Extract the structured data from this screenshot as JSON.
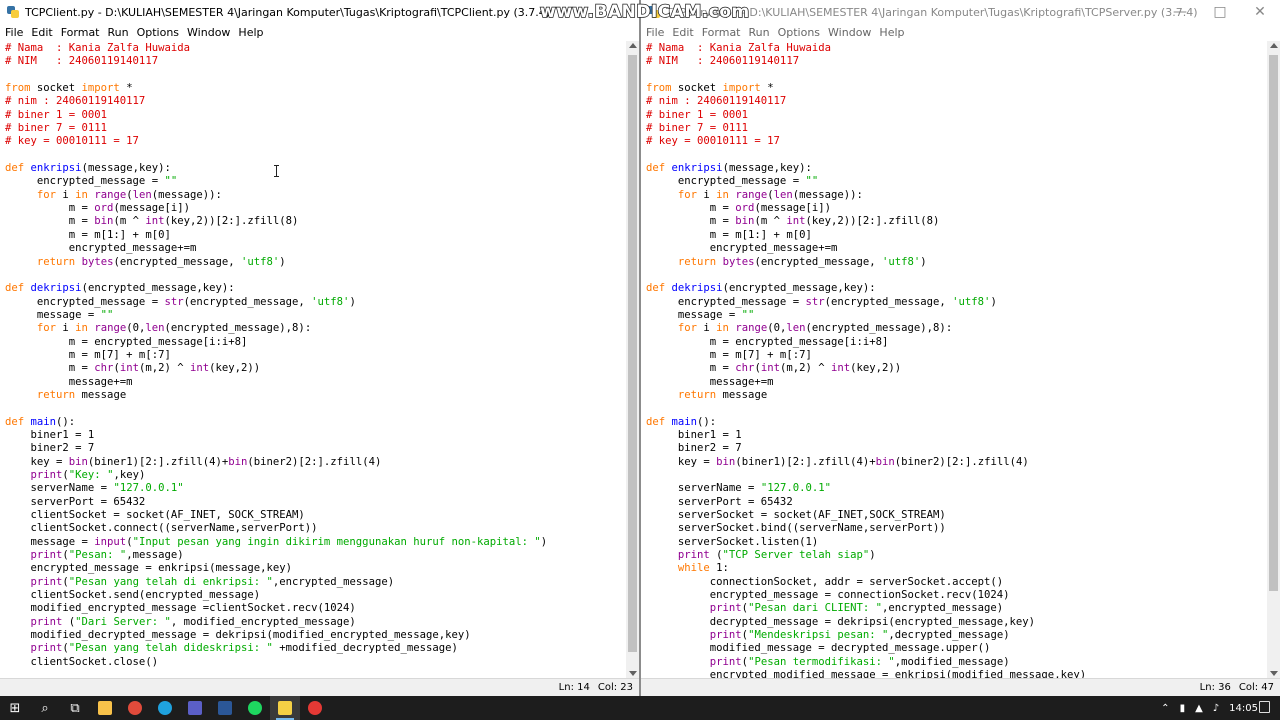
{
  "watermark": "www.BANDICAM.com",
  "left_window": {
    "title": "TCPClient.py - D:\\KULIAH\\SEMESTER 4\\Jaringan Komputer\\Tugas\\Kriptografi\\TCPClient.py (3.7.4)",
    "menu": [
      "File",
      "Edit",
      "Format",
      "Run",
      "Options",
      "Window",
      "Help"
    ],
    "status": {
      "line": "Ln: 14",
      "col": "Col: 23"
    }
  },
  "right_window": {
    "title": "TCPServer.py - D:\\KULIAH\\SEMESTER 4\\Jaringan Komputer\\Tugas\\Kriptografi\\TCPServer.py (3.7.4)",
    "menu": [
      "File",
      "Edit",
      "Format",
      "Run",
      "Options",
      "Window",
      "Help"
    ],
    "status": {
      "line": "Ln: 36",
      "col": "Col: 47"
    }
  },
  "client_code": [
    [
      [
        "cm",
        "# Nama  : Kania Zalfa Huwaida"
      ]
    ],
    [
      [
        "cm",
        "# NIM   : 24060119140117"
      ]
    ],
    [],
    [
      [
        "kw",
        "from"
      ],
      [
        "",
        " socket "
      ],
      [
        "kw",
        "import"
      ],
      [
        "",
        " *"
      ]
    ],
    [
      [
        "cm",
        "# nim : 24060119140117"
      ]
    ],
    [
      [
        "cm",
        "# biner 1 = 0001"
      ]
    ],
    [
      [
        "cm",
        "# biner 7 = 0111"
      ]
    ],
    [
      [
        "cm",
        "# key = 00010111 = 17"
      ]
    ],
    [],
    [
      [
        "kw",
        "def"
      ],
      [
        "",
        " "
      ],
      [
        "df",
        "enkripsi"
      ],
      [
        "",
        "(message,key):"
      ]
    ],
    [
      [
        "",
        "     encrypted_message = "
      ],
      [
        "st",
        "\"\""
      ]
    ],
    [
      [
        "kw",
        "     for"
      ],
      [
        "",
        " i "
      ],
      [
        "kw",
        "in"
      ],
      [
        "",
        " "
      ],
      [
        "bi",
        "range"
      ],
      [
        "",
        "("
      ],
      [
        "bi",
        "len"
      ],
      [
        "",
        "(message)):"
      ]
    ],
    [
      [
        "",
        "          m = "
      ],
      [
        "bi",
        "ord"
      ],
      [
        "",
        "(message[i])"
      ]
    ],
    [
      [
        "",
        "          m = "
      ],
      [
        "bi",
        "bin"
      ],
      [
        "",
        "(m ^ "
      ],
      [
        "bi",
        "int"
      ],
      [
        "",
        "(key,2))[2:].zfill(8)"
      ]
    ],
    [
      [
        "",
        "          m = m[1:] + m[0]"
      ]
    ],
    [
      [
        "",
        "          encrypted_message+=m"
      ]
    ],
    [
      [
        "kw",
        "     return"
      ],
      [
        "",
        " "
      ],
      [
        "bi",
        "bytes"
      ],
      [
        "",
        "(encrypted_message, "
      ],
      [
        "st",
        "'utf8'"
      ],
      [
        "",
        ")"
      ]
    ],
    [],
    [
      [
        "kw",
        "def"
      ],
      [
        "",
        " "
      ],
      [
        "df",
        "dekripsi"
      ],
      [
        "",
        "(encrypted_message,key):"
      ]
    ],
    [
      [
        "",
        "     encrypted_message = "
      ],
      [
        "bi",
        "str"
      ],
      [
        "",
        "(encrypted_message, "
      ],
      [
        "st",
        "'utf8'"
      ],
      [
        "",
        ")"
      ]
    ],
    [
      [
        "",
        "     message = "
      ],
      [
        "st",
        "\"\""
      ]
    ],
    [
      [
        "kw",
        "     for"
      ],
      [
        "",
        " i "
      ],
      [
        "kw",
        "in"
      ],
      [
        "",
        " "
      ],
      [
        "bi",
        "range"
      ],
      [
        "",
        "(0,"
      ],
      [
        "bi",
        "len"
      ],
      [
        "",
        "(encrypted_message),8):"
      ]
    ],
    [
      [
        "",
        "          m = encrypted_message[i:i+8]"
      ]
    ],
    [
      [
        "",
        "          m = m[7] + m[:7]"
      ]
    ],
    [
      [
        "",
        "          m = "
      ],
      [
        "bi",
        "chr"
      ],
      [
        "",
        "("
      ],
      [
        "bi",
        "int"
      ],
      [
        "",
        "(m,2) ^ "
      ],
      [
        "bi",
        "int"
      ],
      [
        "",
        "(key,2))"
      ]
    ],
    [
      [
        "",
        "          message+=m"
      ]
    ],
    [
      [
        "kw",
        "     return"
      ],
      [
        "",
        " message"
      ]
    ],
    [],
    [
      [
        "kw",
        "def"
      ],
      [
        "",
        " "
      ],
      [
        "df",
        "main"
      ],
      [
        "",
        "():"
      ]
    ],
    [
      [
        "",
        "    biner1 = 1"
      ]
    ],
    [
      [
        "",
        "    biner2 = 7"
      ]
    ],
    [
      [
        "",
        "    key = "
      ],
      [
        "bi",
        "bin"
      ],
      [
        "",
        "(biner1)[2:].zfill(4)+"
      ],
      [
        "bi",
        "bin"
      ],
      [
        "",
        "(biner2)[2:].zfill(4)"
      ]
    ],
    [
      [
        "bi",
        "    print"
      ],
      [
        "",
        "("
      ],
      [
        "st",
        "\"Key: \""
      ],
      [
        "",
        ",key)"
      ]
    ],
    [
      [
        "",
        "    serverName = "
      ],
      [
        "st",
        "\"127.0.0.1\""
      ]
    ],
    [
      [
        "",
        "    serverPort = 65432"
      ]
    ],
    [
      [
        "",
        "    clientSocket = socket(AF_INET, SOCK_STREAM)"
      ]
    ],
    [
      [
        "",
        "    clientSocket.connect((serverName,serverPort))"
      ]
    ],
    [
      [
        "",
        "    message = "
      ],
      [
        "bi",
        "input"
      ],
      [
        "",
        "("
      ],
      [
        "st",
        "\"Input pesan yang ingin dikirim menggunakan huruf non-kapital: \""
      ],
      [
        "",
        ")"
      ]
    ],
    [
      [
        "bi",
        "    print"
      ],
      [
        "",
        "("
      ],
      [
        "st",
        "\"Pesan: \""
      ],
      [
        "",
        ",message)"
      ]
    ],
    [
      [
        "",
        "    encrypted_message = enkripsi(message,key)"
      ]
    ],
    [
      [
        "bi",
        "    print"
      ],
      [
        "",
        "("
      ],
      [
        "st",
        "\"Pesan yang telah di enkripsi: \""
      ],
      [
        "",
        ",encrypted_message)"
      ]
    ],
    [
      [
        "",
        "    clientSocket.send(encrypted_message)"
      ]
    ],
    [
      [
        "",
        "    modified_encrypted_message =clientSocket.recv(1024)"
      ]
    ],
    [
      [
        "bi",
        "    print"
      ],
      [
        "",
        " ("
      ],
      [
        "st",
        "\"Dari Server: \""
      ],
      [
        "",
        ", modified_encrypted_message)"
      ]
    ],
    [
      [
        "",
        "    modified_decrypted_message = dekripsi(modified_encrypted_message,key)"
      ]
    ],
    [
      [
        "bi",
        "    print"
      ],
      [
        "",
        "("
      ],
      [
        "st",
        "\"Pesan yang telah dideskripsi: \""
      ],
      [
        "",
        " +modified_decrypted_message)"
      ]
    ],
    [
      [
        "",
        "    clientSocket.close()"
      ]
    ]
  ],
  "server_code": [
    [
      [
        "cm",
        "# Nama  : Kania Zalfa Huwaida"
      ]
    ],
    [
      [
        "cm",
        "# NIM   : 24060119140117"
      ]
    ],
    [],
    [
      [
        "kw",
        "from"
      ],
      [
        "",
        " socket "
      ],
      [
        "kw",
        "import"
      ],
      [
        "",
        " *"
      ]
    ],
    [
      [
        "cm",
        "# nim : 24060119140117"
      ]
    ],
    [
      [
        "cm",
        "# biner 1 = 0001"
      ]
    ],
    [
      [
        "cm",
        "# biner 7 = 0111"
      ]
    ],
    [
      [
        "cm",
        "# key = 00010111 = 17"
      ]
    ],
    [],
    [
      [
        "kw",
        "def"
      ],
      [
        "",
        " "
      ],
      [
        "df",
        "enkripsi"
      ],
      [
        "",
        "(message,key):"
      ]
    ],
    [
      [
        "",
        "     encrypted_message = "
      ],
      [
        "st",
        "\"\""
      ]
    ],
    [
      [
        "kw",
        "     for"
      ],
      [
        "",
        " i "
      ],
      [
        "kw",
        "in"
      ],
      [
        "",
        " "
      ],
      [
        "bi",
        "range"
      ],
      [
        "",
        "("
      ],
      [
        "bi",
        "len"
      ],
      [
        "",
        "(message)):"
      ]
    ],
    [
      [
        "",
        "          m = "
      ],
      [
        "bi",
        "ord"
      ],
      [
        "",
        "(message[i])"
      ]
    ],
    [
      [
        "",
        "          m = "
      ],
      [
        "bi",
        "bin"
      ],
      [
        "",
        "(m ^ "
      ],
      [
        "bi",
        "int"
      ],
      [
        "",
        "(key,2))[2:].zfill(8)"
      ]
    ],
    [
      [
        "",
        "          m = m[1:] + m[0]"
      ]
    ],
    [
      [
        "",
        "          encrypted_message+=m"
      ]
    ],
    [
      [
        "kw",
        "     return"
      ],
      [
        "",
        " "
      ],
      [
        "bi",
        "bytes"
      ],
      [
        "",
        "(encrypted_message, "
      ],
      [
        "st",
        "'utf8'"
      ],
      [
        "",
        ")"
      ]
    ],
    [],
    [
      [
        "kw",
        "def"
      ],
      [
        "",
        " "
      ],
      [
        "df",
        "dekripsi"
      ],
      [
        "",
        "(encrypted_message,key):"
      ]
    ],
    [
      [
        "",
        "     encrypted_message = "
      ],
      [
        "bi",
        "str"
      ],
      [
        "",
        "(encrypted_message, "
      ],
      [
        "st",
        "'utf8'"
      ],
      [
        "",
        ")"
      ]
    ],
    [
      [
        "",
        "     message = "
      ],
      [
        "st",
        "\"\""
      ]
    ],
    [
      [
        "kw",
        "     for"
      ],
      [
        "",
        " i "
      ],
      [
        "kw",
        "in"
      ],
      [
        "",
        " "
      ],
      [
        "bi",
        "range"
      ],
      [
        "",
        "(0,"
      ],
      [
        "bi",
        "len"
      ],
      [
        "",
        "(encrypted_message),8):"
      ]
    ],
    [
      [
        "",
        "          m = encrypted_message[i:i+8]"
      ]
    ],
    [
      [
        "",
        "          m = m[7] + m[:7]"
      ]
    ],
    [
      [
        "",
        "          m = "
      ],
      [
        "bi",
        "chr"
      ],
      [
        "",
        "("
      ],
      [
        "bi",
        "int"
      ],
      [
        "",
        "(m,2) ^ "
      ],
      [
        "bi",
        "int"
      ],
      [
        "",
        "(key,2))"
      ]
    ],
    [
      [
        "",
        "          message+=m"
      ]
    ],
    [
      [
        "kw",
        "     return"
      ],
      [
        "",
        " message"
      ]
    ],
    [],
    [
      [
        "kw",
        "def"
      ],
      [
        "",
        " "
      ],
      [
        "df",
        "main"
      ],
      [
        "",
        "():"
      ]
    ],
    [
      [
        "",
        "     biner1 = 1"
      ]
    ],
    [
      [
        "",
        "     biner2 = 7"
      ]
    ],
    [
      [
        "",
        "     key = "
      ],
      [
        "bi",
        "bin"
      ],
      [
        "",
        "(biner1)[2:].zfill(4)+"
      ],
      [
        "bi",
        "bin"
      ],
      [
        "",
        "(biner2)[2:].zfill(4)"
      ]
    ],
    [],
    [
      [
        "",
        "     serverName = "
      ],
      [
        "st",
        "\"127.0.0.1\""
      ]
    ],
    [
      [
        "",
        "     serverPort = 65432"
      ]
    ],
    [
      [
        "",
        "     serverSocket = socket(AF_INET,SOCK_STREAM)"
      ]
    ],
    [
      [
        "",
        "     serverSocket.bind((serverName,serverPort))"
      ]
    ],
    [
      [
        "",
        "     serverSocket.listen(1)"
      ]
    ],
    [
      [
        "bi",
        "     print"
      ],
      [
        "",
        " ("
      ],
      [
        "st",
        "\"TCP Server telah siap\""
      ],
      [
        "",
        ")"
      ]
    ],
    [
      [
        "kw",
        "     while"
      ],
      [
        "",
        " 1:"
      ]
    ],
    [
      [
        "",
        "          connectionSocket, addr = serverSocket.accept()"
      ]
    ],
    [
      [
        "",
        "          encrypted_message = connectionSocket.recv(1024)"
      ]
    ],
    [
      [
        "bi",
        "          print"
      ],
      [
        "",
        "("
      ],
      [
        "st",
        "\"Pesan dari CLIENT: \""
      ],
      [
        "",
        ",encrypted_message)"
      ]
    ],
    [
      [
        "",
        "          decrypted_message = dekripsi(encrypted_message,key)"
      ]
    ],
    [
      [
        "bi",
        "          print"
      ],
      [
        "",
        "("
      ],
      [
        "st",
        "\"Mendeskripsi pesan: \""
      ],
      [
        "",
        ",decrypted_message)"
      ]
    ],
    [
      [
        "",
        "          modified_message = decrypted_message.upper()"
      ]
    ],
    [
      [
        "bi",
        "          print"
      ],
      [
        "",
        "("
      ],
      [
        "st",
        "\"Pesan termodifikasi: \""
      ],
      [
        "",
        ",modified_message)"
      ]
    ],
    [
      [
        "",
        "          encrypted_modified_message = enkripsi(modified_message,key)"
      ]
    ]
  ],
  "scrollbars": {
    "left": {
      "position": 0,
      "visible_fraction": 0.98
    },
    "right": {
      "position": 0,
      "visible_fraction": 0.88
    }
  },
  "taskbar": {
    "apps": [
      {
        "icon": "windows-start-icon",
        "color": "#ffffff"
      },
      {
        "icon": "search-icon",
        "color": "#ffffff"
      },
      {
        "icon": "task-view-icon",
        "color": "#ffffff"
      },
      {
        "icon": "file-explorer-icon",
        "color": "#f8c24a"
      },
      {
        "icon": "chrome-icon",
        "color": "#e14b3b"
      },
      {
        "icon": "edge-icon",
        "color": "#1fa2de"
      },
      {
        "icon": "teams-icon",
        "color": "#5b5fc7"
      },
      {
        "icon": "word-icon",
        "color": "#2b5797"
      },
      {
        "icon": "spotify-icon",
        "color": "#1ed760"
      },
      {
        "icon": "python-idle-icon",
        "color": "#f4d045"
      },
      {
        "icon": "bandicam-icon",
        "color": "#e53935"
      }
    ],
    "active_index": 9,
    "clock": "14:05"
  },
  "colors": {
    "comment": "#dd0000",
    "keyword": "#ff7700",
    "builtin": "#900090",
    "string": "#00aa00",
    "definition": "#0000ff"
  }
}
